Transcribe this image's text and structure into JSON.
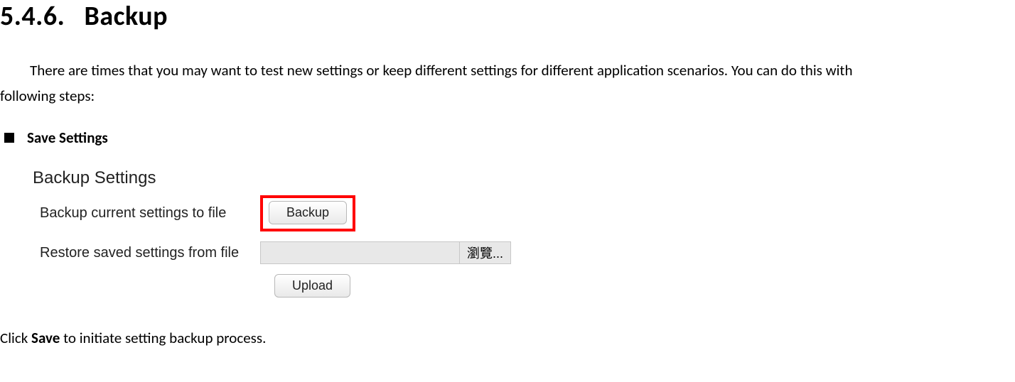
{
  "heading_number": "5.4.6.",
  "heading_text": "Backup",
  "intro_line1": "There are times that you may want to test new settings or keep different settings for different application scenarios. You can do this with",
  "intro_line2": "following steps:",
  "bullet_label": "Save Settings",
  "panel": {
    "title": "Backup Settings",
    "row_backup_label": "Backup current settings to file",
    "backup_button": "Backup",
    "row_restore_label": "Restore saved settings from file",
    "browse_button": "瀏覽...",
    "upload_button": "Upload"
  },
  "instruction_prefix": "Click ",
  "instruction_bold": "Save",
  "instruction_suffix": " to initiate setting backup process."
}
